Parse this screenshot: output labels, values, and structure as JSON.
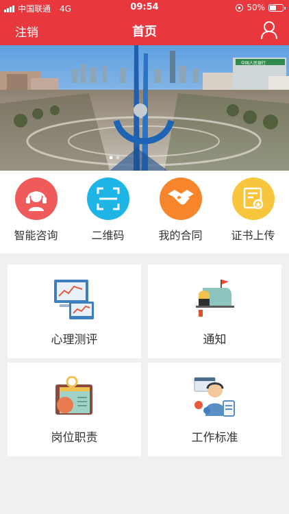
{
  "status_bar": {
    "carrier": "中国联通",
    "network": "4G",
    "time": "09:54",
    "battery": "50%",
    "battery_level": 0.5
  },
  "header": {
    "logout_label": "注销",
    "title": "首页",
    "user_icon": "user-icon"
  },
  "banner": {
    "building_sign": "中国人民银行"
  },
  "quick_actions": [
    {
      "label": "智能咨询",
      "icon": "headset-support-icon",
      "color": "#ef5a5a"
    },
    {
      "label": "二维码",
      "icon": "qr-scan-icon",
      "color": "#1fb4e6"
    },
    {
      "label": "我的合同",
      "icon": "handshake-icon",
      "color": "#f7852b"
    },
    {
      "label": "证书上传",
      "icon": "certificate-icon",
      "color": "#f8c63c"
    }
  ],
  "cards": [
    {
      "label": "心理测评",
      "icon": "monitor-chart-icon"
    },
    {
      "label": "通知",
      "icon": "mailbox-icon"
    },
    {
      "label": "岗位职责",
      "icon": "clipboard-badge-icon"
    },
    {
      "label": "工作标准",
      "icon": "support-agent-icon"
    }
  ],
  "colors": {
    "brand_red": "#e8383d",
    "page_bg": "#f0f0f0"
  }
}
